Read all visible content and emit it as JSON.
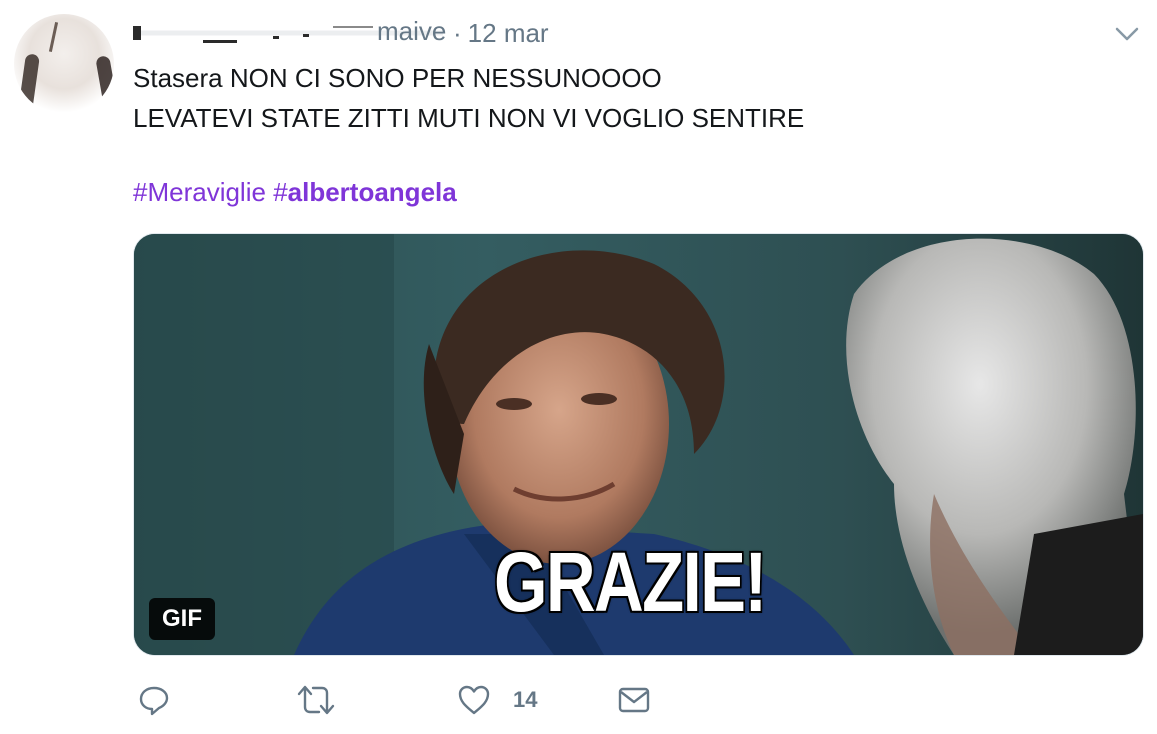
{
  "tweet": {
    "handle_partial": "maive",
    "separator": "·",
    "date": "12 mar",
    "text_line1": "Stasera NON CI SONO PER NESSUNOOOO",
    "text_line2": "LEVATEVI STATE ZITTI MUTI NON VI VOGLIO SENTIRE",
    "hashtag1": "#Meraviglie",
    "hashtag2_prefix": "#",
    "hashtag2_bold": "albertoangela",
    "media": {
      "caption": "GRAZIE!",
      "badge": "GIF"
    },
    "actions": {
      "reply_icon": "reply-icon",
      "retweet_icon": "retweet-icon",
      "like_icon": "like-icon",
      "like_count": "14",
      "dm_icon": "envelope-icon"
    }
  },
  "colors": {
    "hashtag": "#7f35d8",
    "text": "#14171a",
    "muted": "#657786",
    "icon": "#657786"
  }
}
